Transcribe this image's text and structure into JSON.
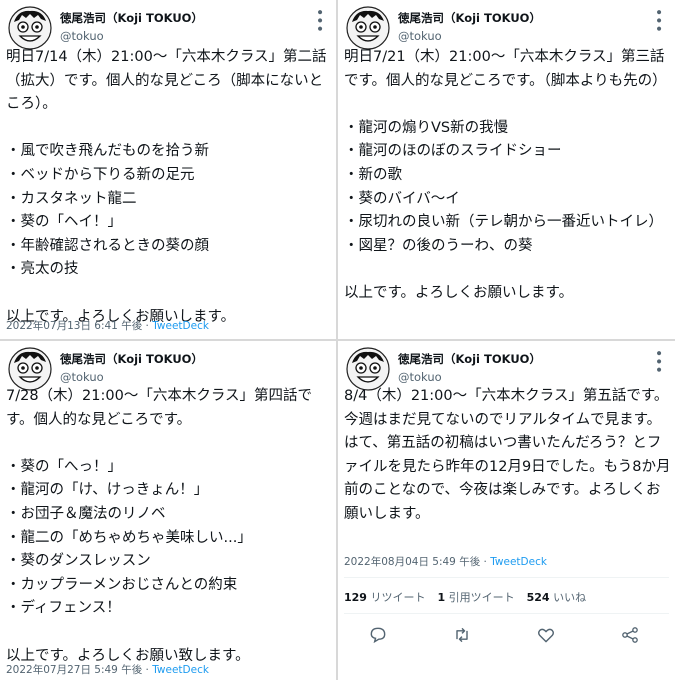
{
  "tweets": [
    {
      "name": "徳尾浩司（Koji TOKUO）",
      "handle": "@tokuo",
      "text": "明日7/14（木）21:00〜「六本木クラス」第二話（拡大）です。個人的な見どころ（脚本にないところ）。\n\n・風で吹き飛んだものを拾う新\n・ベッドから下りる新の足元\n・カスタネット龍二\n・葵の「ヘイ！」\n・年齢確認されるときの葵の顔\n・亮太の技\n\n以上です。よろしくお願いします。",
      "timestamp": "2022年07月13日 6:41 午後",
      "source": "TweetDeck"
    },
    {
      "name": "徳尾浩司（Koji TOKUO）",
      "handle": "@tokuo",
      "text": "明日7/21（木）21:00〜「六本木クラス」第三話です。個人的な見どころです。（脚本よりも先の）\n\n・龍河の煽りVS新の我慢\n・龍河のほのぼのスライドショー\n・新の歌\n・葵のバイバ〜イ\n・尿切れの良い新（テレ朝から一番近いトイレ）\n・図星？の後のうーわ、の葵\n\n以上です。よろしくお願いします。",
      "timestamp": "",
      "source": ""
    },
    {
      "name": "徳尾浩司（Koji TOKUO）",
      "handle": "@tokuo",
      "text": "7/28（木）21:00〜「六本木クラス」第四話です。個人的な見どころです。\n\n・葵の「へっ！」\n・龍河の「け、けっきょん！」\n・お団子＆魔法のリノベ\n・龍二の「めちゃめちゃ美味しい...」\n・葵のダンスレッスン\n・カップラーメンおじさんとの約束\n・ディフェンス！\n\n以上です。よろしくお願い致します。",
      "timestamp": "2022年07月27日 5:49 午後",
      "source": "TweetDeck"
    },
    {
      "name": "徳尾浩司（Koji TOKUO）",
      "handle": "@tokuo",
      "text": "8/4（木）21:00〜「六本木クラス」第五話です。今週はまだ見てないのでリアルタイムで見ます。はて、第五話の初稿はいつ書いたんだろう？とファイルを見たら昨年の12月9日でした。もう8か月前のことなので、今夜は楽しみです。よろしくお願いします。",
      "timestamp": "2022年08月04日 5:49 午後",
      "source": "TweetDeck"
    }
  ],
  "stats": {
    "retweets_count": "129",
    "retweets_label": "リツイート",
    "quotes_count": "1",
    "quotes_label": "引用ツイート",
    "likes_count": "524",
    "likes_label": "いいね"
  },
  "icons": {
    "avatar": "cartoon-avatar-icon",
    "more": "more-options-icon",
    "reply": "reply-icon",
    "retweet": "retweet-icon",
    "like": "like-icon",
    "share": "share-icon"
  },
  "colors": {
    "accent": "#1d9bf0",
    "muted": "#536471",
    "text": "#0f1419"
  }
}
